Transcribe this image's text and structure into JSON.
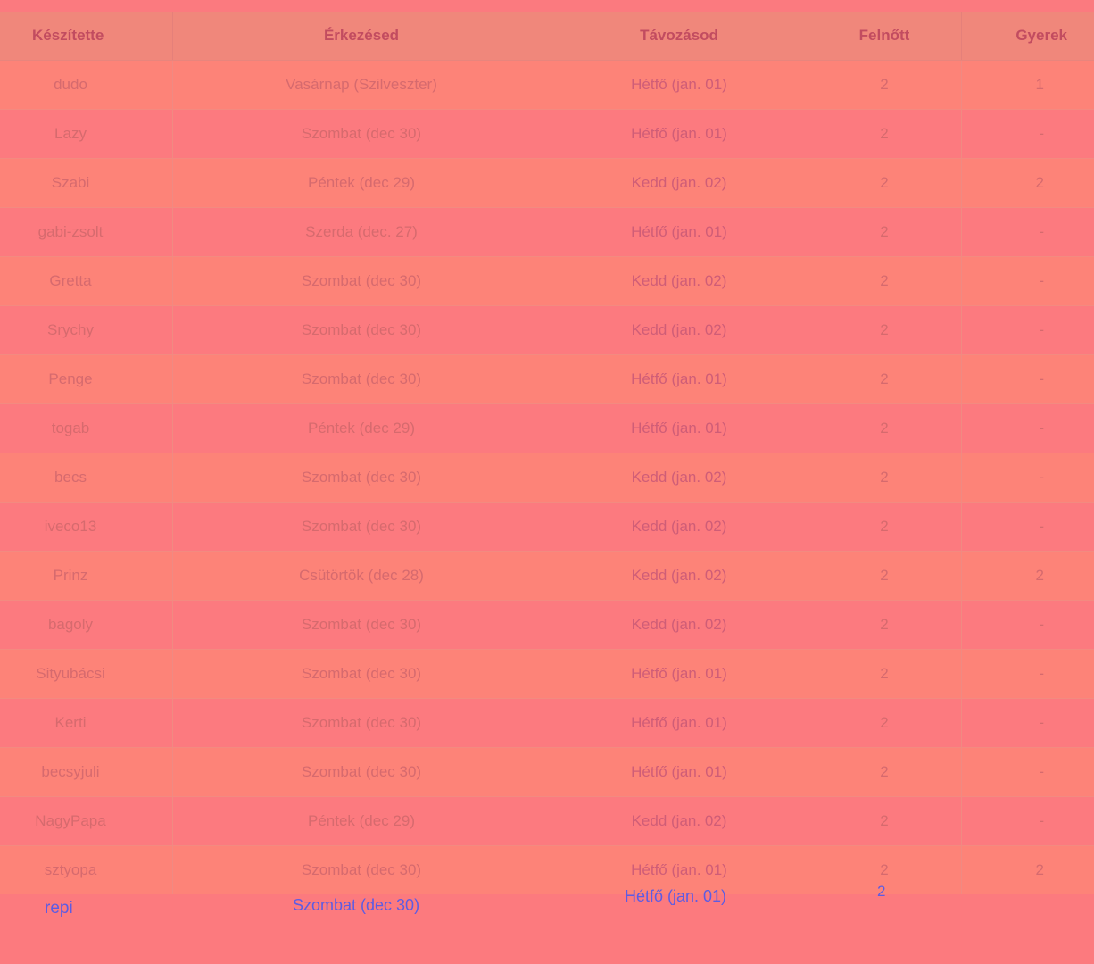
{
  "table": {
    "headers": [
      "Készítette",
      "Érkezésed",
      "Távozásod",
      "Felnőtt",
      "Gyerek"
    ],
    "rows": [
      {
        "user": "dudo",
        "arrival": "Vasárnap (Szilveszter)",
        "departure": "Hétfő (jan. 01)",
        "adults": "2",
        "children": "1"
      },
      {
        "user": "Lazy",
        "arrival": "Szombat (dec 30)",
        "departure": "Hétfő (jan. 01)",
        "adults": "2",
        "children": "-"
      },
      {
        "user": "Szabi",
        "arrival": "Péntek (dec 29)",
        "departure": "Kedd (jan. 02)",
        "adults": "2",
        "children": "2"
      },
      {
        "user": "gabi-zsolt",
        "arrival": "Szerda (dec. 27)",
        "departure": "Hétfő (jan. 01)",
        "adults": "2",
        "children": "-"
      },
      {
        "user": "Gretta",
        "arrival": "Szombat (dec 30)",
        "departure": "Kedd (jan. 02)",
        "adults": "2",
        "children": "-"
      },
      {
        "user": "Srychy",
        "arrival": "Szombat (dec 30)",
        "departure": "Kedd (jan. 02)",
        "adults": "2",
        "children": "-"
      },
      {
        "user": "Penge",
        "arrival": "Szombat (dec 30)",
        "departure": "Hétfő (jan. 01)",
        "adults": "2",
        "children": "-"
      },
      {
        "user": "togab",
        "arrival": "Péntek (dec 29)",
        "departure": "Hétfő (jan. 01)",
        "adults": "2",
        "children": "-"
      },
      {
        "user": "becs",
        "arrival": "Szombat (dec 30)",
        "departure": "Kedd (jan. 02)",
        "adults": "2",
        "children": "-"
      },
      {
        "user": "iveco13",
        "arrival": "Szombat (dec 30)",
        "departure": "Kedd (jan. 02)",
        "adults": "2",
        "children": "-"
      },
      {
        "user": "Prinz",
        "arrival": "Csütörtök (dec 28)",
        "departure": "Kedd (jan. 02)",
        "adults": "2",
        "children": "2"
      },
      {
        "user": "bagoly",
        "arrival": "Szombat (dec 30)",
        "departure": "Kedd (jan. 02)",
        "adults": "2",
        "children": "-"
      },
      {
        "user": "Sityubácsi",
        "arrival": "Szombat (dec 30)",
        "departure": "Hétfő (jan. 01)",
        "adults": "2",
        "children": "-"
      },
      {
        "user": "Kerti",
        "arrival": "Szombat (dec 30)",
        "departure": "Hétfő (jan. 01)",
        "adults": "2",
        "children": "-"
      },
      {
        "user": "becsyjuli",
        "arrival": "Szombat (dec 30)",
        "departure": "Hétfő (jan. 01)",
        "adults": "2",
        "children": "-"
      },
      {
        "user": "NagyPapa",
        "arrival": "Péntek (dec 29)",
        "departure": "Kedd (jan. 02)",
        "adults": "2",
        "children": "-"
      },
      {
        "user": "sztyopa",
        "arrival": "Szombat (dec 30)",
        "departure": "Hétfő (jan. 01)",
        "adults": "2",
        "children": "2"
      }
    ]
  },
  "pending_row": {
    "user": "repi",
    "arrival": "Szombat (dec 30)",
    "departure": "Hétfő (jan. 01)",
    "adults": "2"
  }
}
